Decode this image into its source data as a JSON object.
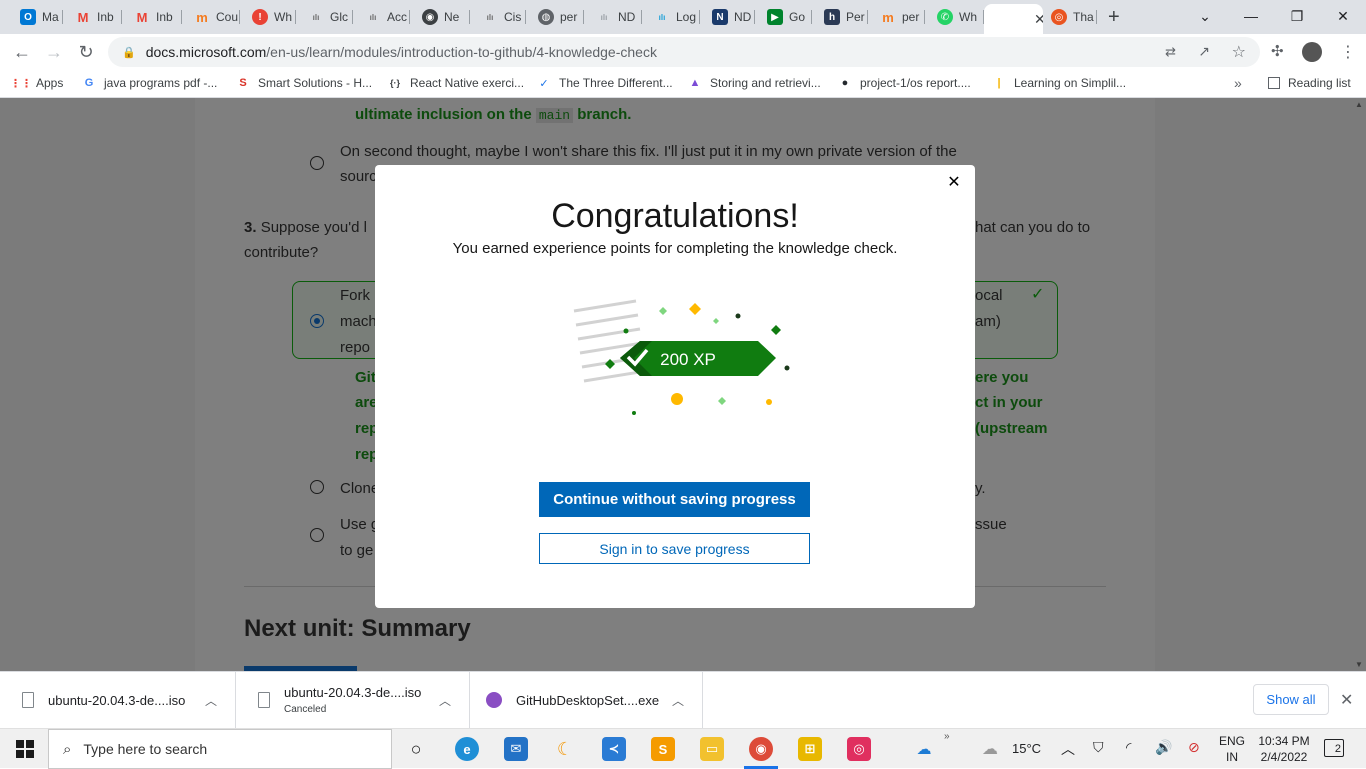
{
  "tabs": [
    {
      "label": "Ma",
      "icon": "outlook-icon",
      "color": "#0078d4"
    },
    {
      "label": "Inb",
      "icon": "gmail-icon",
      "color": "#ea4335"
    },
    {
      "label": "Inb",
      "icon": "gmail-icon",
      "color": "#ea4335"
    },
    {
      "label": "Cou",
      "icon": "coursera-icon",
      "color": "#f47b20"
    },
    {
      "label": "Wh",
      "icon": "alert-icon",
      "color": "#e94235"
    },
    {
      "label": "Glc",
      "icon": "cisco-icon",
      "color": "#6b6b6b"
    },
    {
      "label": "Acc",
      "icon": "cisco-icon",
      "color": "#6b6b6b"
    },
    {
      "label": "Ne",
      "icon": "chrome-icon",
      "color": "#3c4043"
    },
    {
      "label": "Cis",
      "icon": "cisco-icon",
      "color": "#6b6b6b"
    },
    {
      "label": "per",
      "icon": "globe-icon",
      "color": "#5f6368"
    },
    {
      "label": "ND",
      "icon": "cisco-icon",
      "color": "#9aa0a6"
    },
    {
      "label": "Log",
      "icon": "cisco-icon",
      "color": "#1ba0d7"
    },
    {
      "label": "ND",
      "icon": "notion-icon",
      "color": "#1a3a6b"
    },
    {
      "label": "Go",
      "icon": "meet-icon",
      "color": "#00832d"
    },
    {
      "label": "Per",
      "icon": "hackerrank-icon",
      "color": "#2b3a55"
    },
    {
      "label": "per",
      "icon": "coursera-icon",
      "color": "#f47b20"
    },
    {
      "label": "Wh",
      "icon": "whatsapp-icon",
      "color": "#25d366"
    },
    {
      "label": "",
      "icon": "microsoft-icon",
      "color": "#f25022"
    },
    {
      "label": "Tha",
      "icon": "ubuntu-icon",
      "color": "#e95420"
    }
  ],
  "url": {
    "domain": "docs.microsoft.com",
    "path": "/en-us/learn/modules/introduction-to-github/4-knowledge-check"
  },
  "bookmarks": [
    {
      "label": "Apps",
      "icon": "apps-grid-icon"
    },
    {
      "label": "java programs pdf -...",
      "icon": "google-icon"
    },
    {
      "label": "Smart Solutions - H...",
      "icon": "s-logo-icon"
    },
    {
      "label": "React Native exerci...",
      "icon": "code-braces-icon"
    },
    {
      "label": "The Three Different...",
      "icon": "shield-check-icon"
    },
    {
      "label": "Storing and retrievi...",
      "icon": "triangle-logo-icon"
    },
    {
      "label": "project-1/os report....",
      "icon": "github-icon"
    },
    {
      "label": "Learning on Simplil...",
      "icon": "simplilearn-icon"
    }
  ],
  "reading_list": "Reading list",
  "article": {
    "prev_feedback": "ultimate inclusion on the",
    "prev_feedback_code": "main",
    "prev_feedback_end": "branch.",
    "option_private_1": "On second thought, maybe I won't share this fix. I'll just put it in my own private version of the",
    "option_private_2": "sourc",
    "q3_num": "3.",
    "q3_left": "Suppose you'd l",
    "q3_right": "hat can you do to",
    "q3_line2": "contribute?",
    "ans_l1": "Fork",
    "ans_l1r": "ocal",
    "ans_l2": "mach",
    "ans_l2r": "am)",
    "ans_l3": "repo",
    "fb_l1": "Git",
    "fb_l1r": "ere you",
    "fb_l2": "are",
    "fb_l2r": "ct in your",
    "fb_l3": "rep",
    "fb_l3r": "(upstream",
    "fb_l4": "rep",
    "opt_clone": "Clone",
    "opt_clone_r": "y.",
    "opt_use_1": "Use g",
    "opt_use_1r": "ssue",
    "opt_use_2": "to ge",
    "next_unit": "Next unit: Summary"
  },
  "modal": {
    "title": "Congratulations!",
    "subtitle": "You earned experience points for completing the knowledge check.",
    "xp": "200 XP",
    "continue_label": "Continue without saving progress",
    "signin_label": "Sign in to save progress",
    "accent": "#107c10",
    "button_color": "#0067b8"
  },
  "downloads": [
    {
      "name": "ubuntu-20.04.3-de....iso",
      "status": ""
    },
    {
      "name": "ubuntu-20.04.3-de....iso",
      "status": "Canceled"
    },
    {
      "name": "GitHubDesktopSet....exe",
      "status": ""
    }
  ],
  "show_all": "Show all",
  "taskbar": {
    "search_placeholder": "Type here to search",
    "weather": "15°C",
    "lang1": "ENG",
    "lang2": "IN",
    "time": "10:34 PM",
    "date": "2/4/2022",
    "notifications": "2"
  }
}
